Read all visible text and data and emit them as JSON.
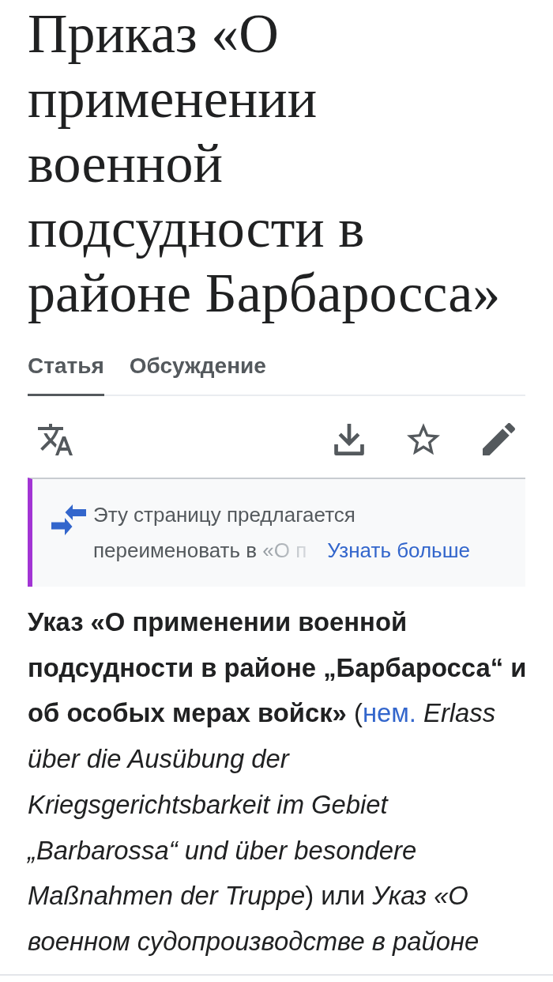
{
  "title": "Приказ «О применении военной подсудности в районе Барбаросса»",
  "tabs": [
    {
      "label": "Статья",
      "selected": true
    },
    {
      "label": "Обсуждение",
      "selected": false
    }
  ],
  "notice": {
    "message": "Эту страницу предлагается переименовать в",
    "message_faded": "«О п",
    "link": "Узнать больше"
  },
  "article": {
    "lead": "**Указ «О применении военной подсудности в районе „Барбаросса“ и об особых мерах войск»** (",
    "link": "нем.",
    "rest": " *Erlass über die Ausübung der Kriegsgerichtsbarkeit im Gebiet „Barbarossa“ und über besondere Maßnahmen der Truppe*) или *Указ «О военном судопроизводстве в районе*"
  }
}
